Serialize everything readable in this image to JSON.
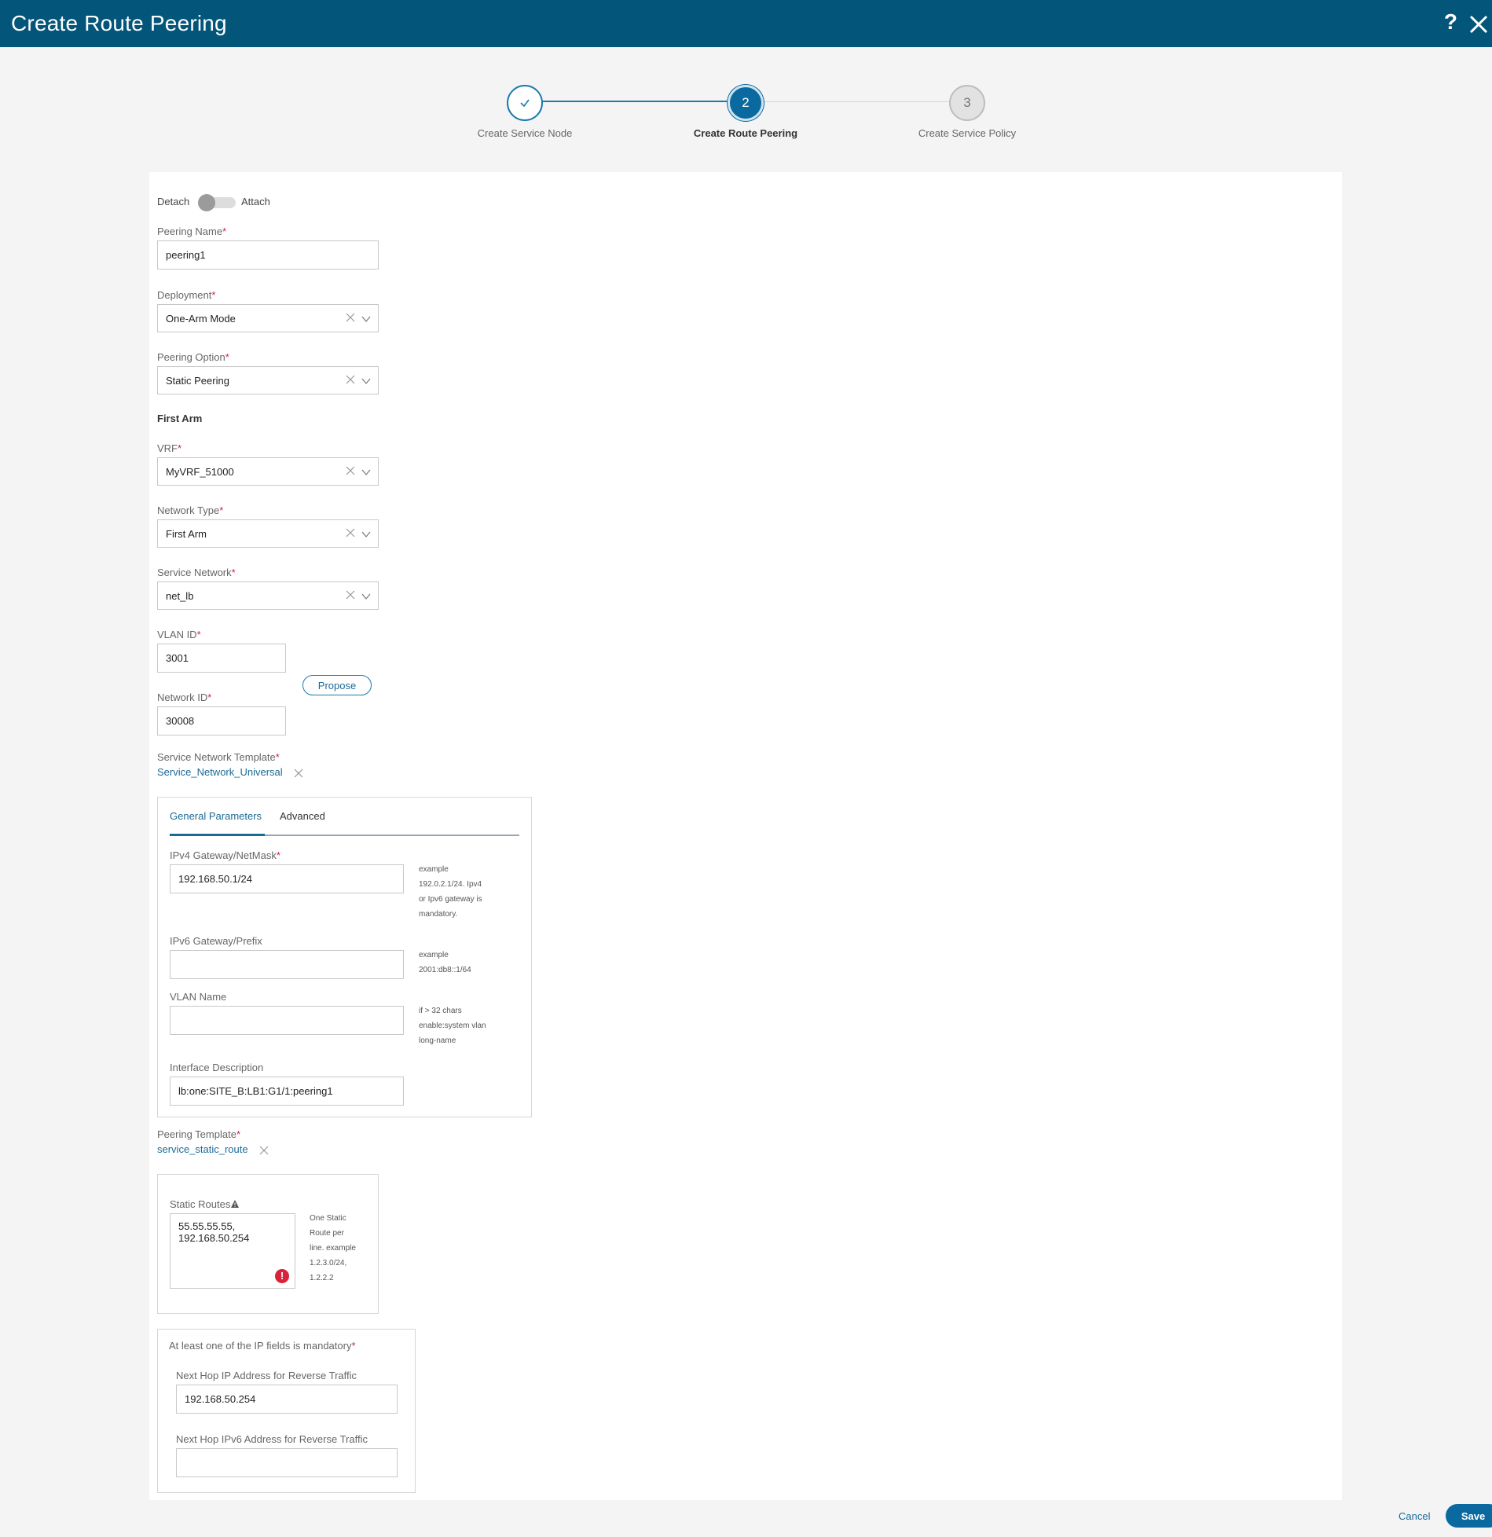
{
  "header": {
    "title": "Create Route Peering",
    "help_label": "?"
  },
  "stepper": {
    "steps": [
      {
        "number": "✓",
        "label": "Create Service Node",
        "state": "done"
      },
      {
        "number": "2",
        "label": "Create Route Peering",
        "state": "active"
      },
      {
        "number": "3",
        "label": "Create Service Policy",
        "state": "pending"
      }
    ]
  },
  "form": {
    "toggle": {
      "left_label": "Detach",
      "right_label": "Attach"
    },
    "peering_name": {
      "label": "Peering Name",
      "value": "peering1"
    },
    "deployment": {
      "label": "Deployment",
      "value": "One-Arm Mode"
    },
    "peering_option": {
      "label": "Peering Option",
      "value": "Static Peering"
    },
    "first_arm_title": "First Arm",
    "vrf": {
      "label": "VRF",
      "value": "MyVRF_51000"
    },
    "network_type": {
      "label": "Network Type",
      "value": "First Arm"
    },
    "service_network": {
      "label": "Service Network",
      "value": "net_lb"
    },
    "vlan_id": {
      "label": "VLAN ID",
      "value": "3001"
    },
    "propose_label": "Propose",
    "network_id": {
      "label": "Network ID",
      "value": "30008"
    },
    "service_network_template": {
      "label": "Service Network Template",
      "value": "Service_Network_Universal"
    },
    "tabs": {
      "general": "General Parameters",
      "advanced": "Advanced"
    },
    "ipv4": {
      "label": "IPv4 Gateway/NetMask",
      "value": "192.168.50.1/24",
      "help": "example 192.0.2.1/24. Ipv4 or Ipv6 gateway is mandatory."
    },
    "ipv6": {
      "label": "IPv6 Gateway/Prefix",
      "value": "",
      "help": "example 2001:db8::1/64"
    },
    "vlan_name": {
      "label": "VLAN Name",
      "value": "",
      "help": "if > 32 chars enable:system vlan long-name"
    },
    "interface_description": {
      "label": "Interface Description",
      "value": "lb:one:SITE_B:LB1:G1/1:peering1"
    },
    "peering_template": {
      "label": "Peering Template",
      "value": "service_static_route"
    },
    "static_routes": {
      "label": "Static Routes",
      "value": "55.55.55.55,\n192.168.50.254",
      "help": "One Static Route per line. example 1.2.3.0/24, 1.2.2.2",
      "error_glyph": "!"
    },
    "ip_fields_note": "At least one of the IP fields is mandatory",
    "next_hop_ipv4": {
      "label": "Next Hop IP Address for Reverse Traffic",
      "value": "192.168.50.254"
    },
    "next_hop_ipv6": {
      "label": "Next Hop IPv6 Address for Reverse Traffic",
      "value": ""
    },
    "required_mark": "*"
  },
  "footer": {
    "cancel_label": "Cancel",
    "save_label": "Save"
  },
  "colors": {
    "header_bg": "#04557a",
    "accent": "#0a6aa0",
    "required": "#c7254e",
    "error": "#d9223c"
  }
}
